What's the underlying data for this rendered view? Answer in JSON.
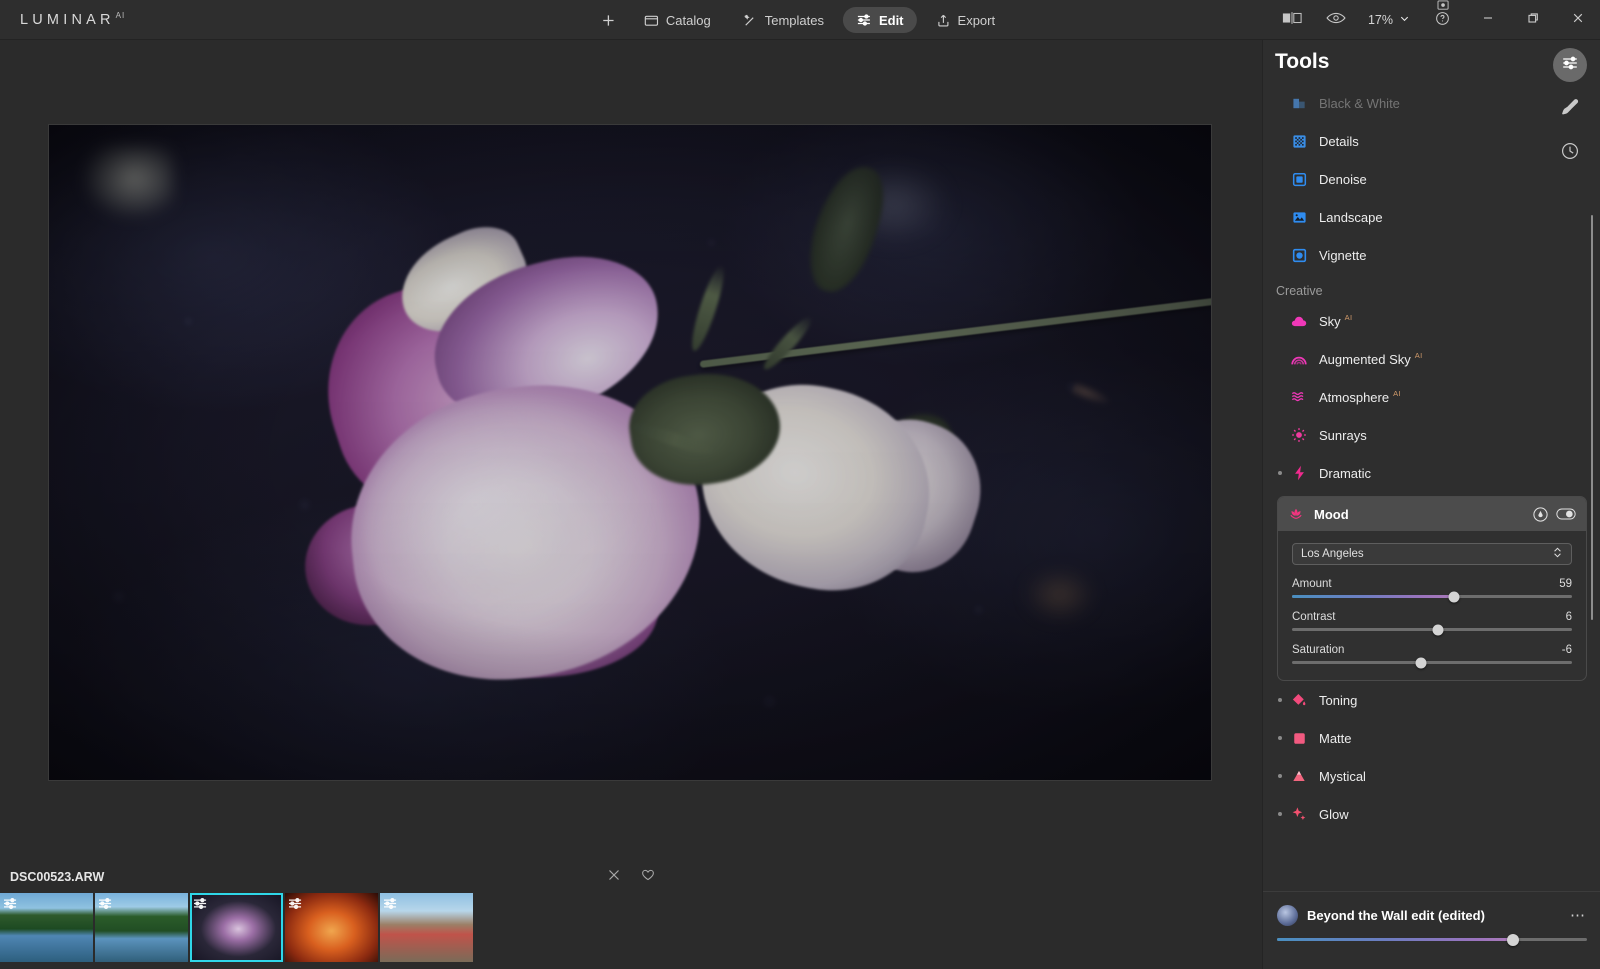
{
  "app": {
    "brand_name": "LUMINAR",
    "brand_superscript": "AI"
  },
  "topbar": {
    "nav": [
      {
        "label": "",
        "icon": "plus-icon",
        "active": false
      },
      {
        "label": "Catalog",
        "icon": "folder-icon",
        "active": false
      },
      {
        "label": "Templates",
        "icon": "sparkle-wand-icon",
        "active": false
      },
      {
        "label": "Edit",
        "icon": "sliders-icon",
        "active": true
      },
      {
        "label": "Export",
        "icon": "share-upload-icon",
        "active": false
      }
    ],
    "compare_icon": "before-after-compare-icon",
    "preview_icon": "eye-icon",
    "zoom_level": "17%",
    "zoom_chevron": "chevron-down-icon",
    "help_icon": "help-question-icon",
    "window_minimize": "minimize-icon",
    "window_restore": "restore-icon",
    "window_close": "close-icon"
  },
  "canvas": {
    "image_alt": "purple and white rose on dark background"
  },
  "filmstrip": {
    "filename": "DSC00523.ARW",
    "reject_icon": "close-icon",
    "favorite_icon": "heart-icon",
    "thumbnails": [
      {
        "name": "lake-reflection-1",
        "klass": "tm-lake",
        "selected": false
      },
      {
        "name": "lake-reflection-2",
        "klass": "tm-lake2",
        "selected": false
      },
      {
        "name": "purple-rose",
        "klass": "tm-rose",
        "selected": true
      },
      {
        "name": "orange-rose",
        "klass": "tm-orange",
        "selected": false
      },
      {
        "name": "portrait-red-hair",
        "klass": "tm-lady",
        "selected": false
      }
    ]
  },
  "panel": {
    "title": "Tools",
    "rail": [
      {
        "name": "edit-sliders",
        "icon": "sliders-icon",
        "active": true
      },
      {
        "name": "brush",
        "icon": "brush-icon",
        "active": false
      },
      {
        "name": "history",
        "icon": "clock-history-icon",
        "active": false
      }
    ],
    "essentials_tools": [
      {
        "label": "Black & White",
        "icon": "black-white-icon",
        "color": "#4d8fd6",
        "faded": true,
        "dot": false
      },
      {
        "label": "Details",
        "icon": "details-grid-icon",
        "color": "#3a8ee6",
        "faded": false,
        "dot": false
      },
      {
        "label": "Denoise",
        "icon": "denoise-square-icon",
        "color": "#2f8cf0",
        "faded": false,
        "dot": false
      },
      {
        "label": "Landscape",
        "icon": "landscape-photo-icon",
        "color": "#2f8cf0",
        "faded": false,
        "dot": false
      },
      {
        "label": "Vignette",
        "icon": "vignette-icon",
        "color": "#2f8cf0",
        "faded": false,
        "dot": false
      }
    ],
    "creative_section_label": "Creative",
    "creative_tools": [
      {
        "label": "Sky",
        "ai": "AI",
        "icon": "cloud-icon",
        "color": "#f038b8",
        "dot": false
      },
      {
        "label": "Augmented Sky",
        "ai": "AI",
        "icon": "rainbow-icon",
        "color": "#f038b8",
        "dot": false
      },
      {
        "label": "Atmosphere",
        "ai": "AI",
        "icon": "waves-icon",
        "color": "#f038b8",
        "dot": false
      },
      {
        "label": "Sunrays",
        "ai": "",
        "icon": "sun-icon",
        "color": "#f03a9e",
        "dot": false
      },
      {
        "label": "Dramatic",
        "ai": "",
        "icon": "lightning-icon",
        "color": "#f02a8e",
        "dot": true
      }
    ],
    "creative_tools_after": [
      {
        "label": "Toning",
        "ai": "",
        "icon": "paint-bucket-icon",
        "color": "#f24a7c",
        "dot": true
      },
      {
        "label": "Matte",
        "ai": "",
        "icon": "matte-square-icon",
        "color": "#f25a80",
        "dot": true
      },
      {
        "label": "Mystical",
        "ai": "",
        "icon": "mountain-icon",
        "color": "#f2667f",
        "dot": true
      },
      {
        "label": "Glow",
        "ai": "",
        "icon": "sparkle-icon",
        "color": "#f2516f",
        "dot": true
      }
    ],
    "mood": {
      "title": "Mood",
      "icon": "mood-lotus-icon",
      "mask_icon": "masking-icon",
      "toggle_icon": "visibility-toggle-icon",
      "preset_value": "Los Angeles",
      "preset_chevron": "chevron-updown-icon",
      "sliders": [
        {
          "label": "Amount",
          "value": "59",
          "pct": 58,
          "gradient": true
        },
        {
          "label": "Contrast",
          "value": "6",
          "pct": 52,
          "gradient": false
        },
        {
          "label": "Saturation",
          "value": "-6",
          "pct": 46,
          "gradient": false
        }
      ]
    },
    "footer": {
      "template_name": "Beyond the Wall edit (edited)",
      "more_icon": "more-dots-icon",
      "strength_pct": 76
    }
  }
}
